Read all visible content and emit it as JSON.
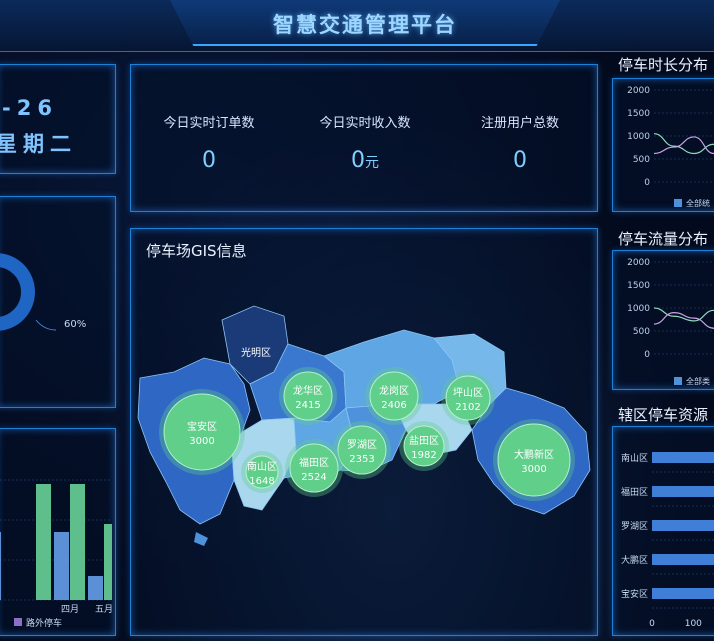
{
  "header": {
    "title": "智慧交通管理平台"
  },
  "date_panel": {
    "date_fragment": "-26",
    "weekday": "星期二"
  },
  "kpis": [
    {
      "label": "今日实时订单数",
      "value": "0",
      "unit": ""
    },
    {
      "label": "今日实时收入数",
      "value": "0",
      "unit": "元"
    },
    {
      "label": "注册用户总数",
      "value": "0",
      "unit": ""
    }
  ],
  "donut": {
    "percent_label": "60%"
  },
  "bar_panel": {
    "month_labels": [
      "四月",
      "五月"
    ],
    "legend_label": "路外停车",
    "colors": {
      "series_a": "#5b8fd6",
      "series_b": "#5fbf8c"
    },
    "chart_data": {
      "type": "bar",
      "categories": [
        "",
        "",
        "四月",
        "五月"
      ],
      "series": [
        {
          "name": "",
          "values": [
            1.7,
            0,
            1.7,
            0.6
          ]
        },
        {
          "name": "路外停车",
          "values": [
            0,
            2.9,
            2.9,
            1.9
          ]
        }
      ]
    }
  },
  "gis": {
    "title": "停车场GIS信息",
    "map_colors": {
      "dark": "#1a3a78",
      "mid": "#2f67c4",
      "light": "#5ea6e4",
      "pale": "#a9d8ee",
      "bubble": "#5fcf8a"
    },
    "districts": [
      {
        "name": "光明区",
        "value": ""
      },
      {
        "name": "宝安区",
        "value": "3000"
      },
      {
        "name": "龙华区",
        "value": "2415"
      },
      {
        "name": "龙岗区",
        "value": "2406"
      },
      {
        "name": "坪山区",
        "value": "2102"
      },
      {
        "name": "罗湖区",
        "value": "2353"
      },
      {
        "name": "盐田区",
        "value": "1982"
      },
      {
        "name": "南山区",
        "value": "1648"
      },
      {
        "name": "福田区",
        "value": "2524"
      },
      {
        "name": "大鹏新区",
        "value": "3000"
      }
    ]
  },
  "parking_duration": {
    "title": "停车时长分布",
    "y_ticks": [
      "2000",
      "1500",
      "1000",
      "500",
      "0"
    ],
    "legend_label": "全部统",
    "chart_data": {
      "type": "line",
      "ylim": [
        0,
        2000
      ],
      "series": [
        {
          "name": "全部统",
          "values": [
            1050,
            780,
            620,
            820
          ]
        },
        {
          "name": "",
          "values": [
            620,
            760,
            980,
            620
          ]
        }
      ]
    }
  },
  "parking_flow": {
    "title": "停车流量分布",
    "y_ticks": [
      "2000",
      "1500",
      "1000",
      "500",
      "0"
    ],
    "legend_label": "全部类",
    "chart_data": {
      "type": "line",
      "ylim": [
        0,
        2000
      ],
      "series": [
        {
          "name": "全部类",
          "values": [
            1000,
            820,
            720,
            950
          ]
        },
        {
          "name": "",
          "values": [
            650,
            900,
            780,
            560
          ]
        }
      ]
    }
  },
  "district_resources": {
    "title": "辖区停车资源",
    "chart_data": {
      "type": "bar",
      "categories": [
        "南山区",
        "福田区",
        "罗湖区",
        "大鹏区",
        "宝安区"
      ],
      "x_ticks": [
        "0",
        "100"
      ],
      "values": [
        150,
        150,
        150,
        150,
        150
      ]
    }
  }
}
